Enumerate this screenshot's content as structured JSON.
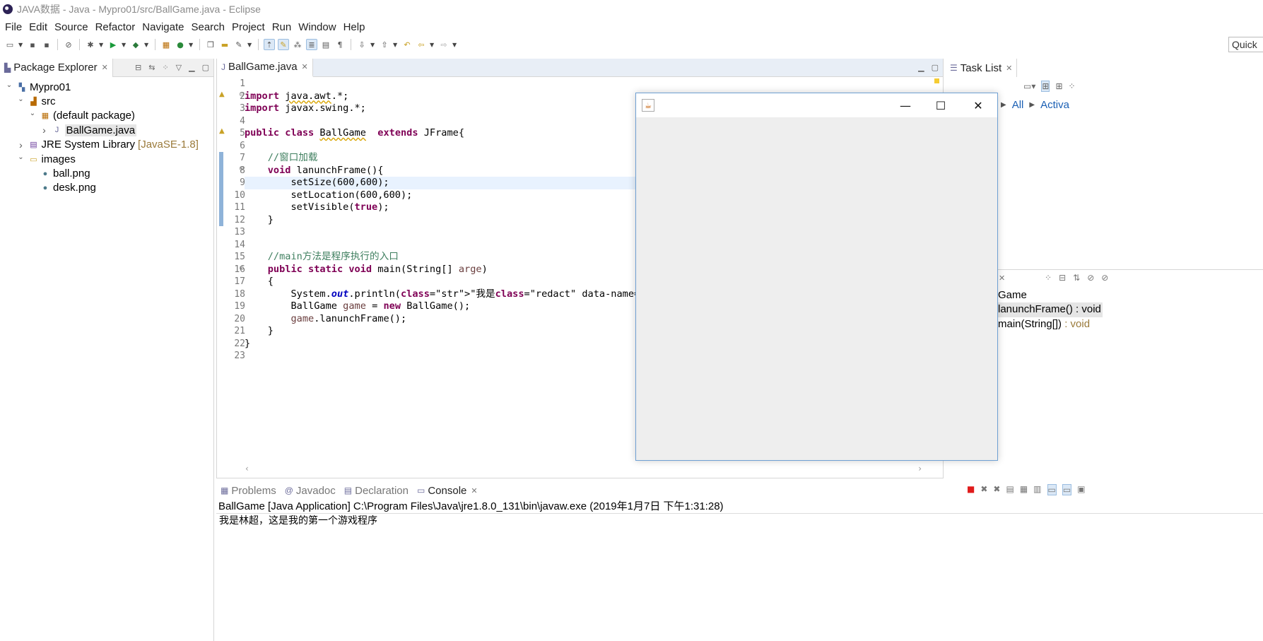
{
  "window": {
    "title": "JAVA数据 - Java - Mypro01/src/BallGame.java - Eclipse"
  },
  "menu": [
    "File",
    "Edit",
    "Source",
    "Refactor",
    "Navigate",
    "Search",
    "Project",
    "Run",
    "Window",
    "Help"
  ],
  "quick_access": {
    "label": "Quick"
  },
  "package_explorer": {
    "tab_label": "Package Explorer",
    "tree": [
      {
        "label": "Mypro01",
        "twisty": "open",
        "indent": 0,
        "icon": "project-icon"
      },
      {
        "label": "src",
        "twisty": "open",
        "indent": 1,
        "icon": "source-folder-icon"
      },
      {
        "label": "(default package)",
        "twisty": "open",
        "indent": 2,
        "icon": "package-icon"
      },
      {
        "label": "BallGame.java",
        "twisty": "closed",
        "indent": 3,
        "icon": "java-file-icon",
        "selected": true
      },
      {
        "label": "JRE System Library",
        "decoration": "[JavaSE-1.8]",
        "twisty": "closed",
        "indent": 1,
        "icon": "library-icon"
      },
      {
        "label": "images",
        "twisty": "open",
        "indent": 1,
        "icon": "folder-icon"
      },
      {
        "label": "ball.png",
        "twisty": "none",
        "indent": 2,
        "icon": "image-file-icon"
      },
      {
        "label": "desk.png",
        "twisty": "none",
        "indent": 2,
        "icon": "image-file-icon"
      }
    ]
  },
  "editor": {
    "tab_label": "BallGame.java",
    "lines": [
      "",
      "import java.awt.*;",
      "import javax.swing.*;",
      "",
      "public class BallGame  extends JFrame{",
      "",
      "    //窗口加载",
      "    void lanunchFrame(){",
      "        setSize(600,600);",
      "        setLocation(600,600);",
      "        setVisible(true);",
      "    }",
      "",
      "",
      "    //main方法是程序执行的入口",
      "    public static void main(String[] arge)",
      "    {",
      "        System.out.println(\"我是██，这是我的第一个游戏程序\");",
      "        BallGame game = new BallGame();",
      "        game.lanunchFrame();",
      "    }",
      "}",
      ""
    ],
    "current_line": 9
  },
  "task_list": {
    "tab_label": "Task List",
    "filter_all": "All",
    "filter_activate": "Activa"
  },
  "outline": {
    "items": [
      {
        "name": "Game",
        "type": ""
      },
      {
        "name": "lanunchFrame()",
        "type": " : void",
        "selected": true
      },
      {
        "name": "main(String[])",
        "type": " : void"
      }
    ]
  },
  "console": {
    "tabs": [
      {
        "label": "Problems",
        "icon": "problems-icon"
      },
      {
        "label": "Javadoc",
        "icon": "at-icon"
      },
      {
        "label": "Declaration",
        "icon": "declaration-icon"
      },
      {
        "label": "Console",
        "icon": "console-icon",
        "active": true
      }
    ],
    "header": "BallGame [Java Application] C:\\Program Files\\Java\\jre1.8.0_131\\bin\\javaw.exe (2019年1月7日 下午1:31:28)",
    "output": "我是林超，这是我的第一个游戏程序"
  },
  "java_window": {
    "icon": "java-cup-icon"
  }
}
